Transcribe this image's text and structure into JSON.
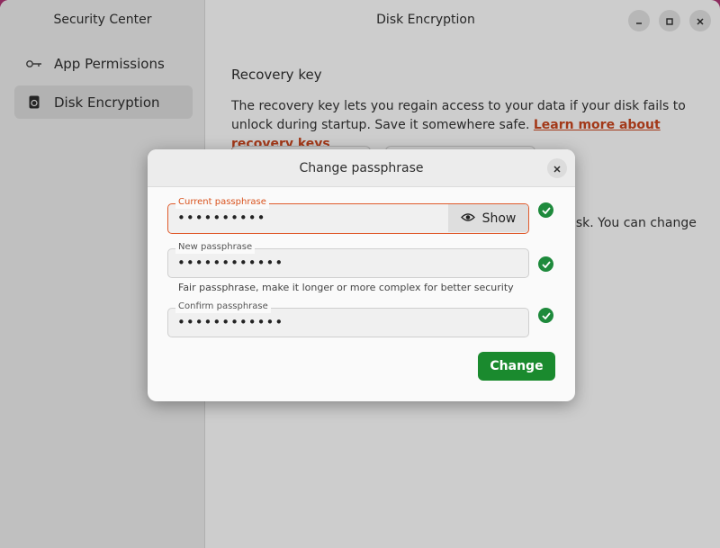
{
  "sidebar": {
    "title": "Security Center",
    "items": [
      {
        "label": "App Permissions",
        "icon": "key-icon"
      },
      {
        "label": "Disk Encryption",
        "icon": "disk-icon",
        "active": true
      }
    ]
  },
  "main": {
    "title": "Disk Encryption",
    "section_heading": "Recovery key",
    "description": "The recovery key lets you regain access to your data if your disk fails to unlock during startup. Save it somewhere safe.",
    "link": "Learn more about recovery keys",
    "partial_text": "e disk. You can change"
  },
  "dialog": {
    "title": "Change passphrase",
    "fields": {
      "current": {
        "label": "Current passphrase",
        "value": "••••••••••"
      },
      "new": {
        "label": "New passphrase",
        "value": "••••••••••••"
      },
      "confirm": {
        "label": "Confirm passphrase",
        "value": "••••••••••••"
      }
    },
    "show_label": "Show",
    "hint": "Fair passphrase, make it longer or more complex for better security",
    "submit_label": "Change"
  },
  "colors": {
    "accent": "#e05a2b",
    "link": "#c7461f",
    "success": "#1e8a3c",
    "primary_button": "#1a8a2e"
  }
}
